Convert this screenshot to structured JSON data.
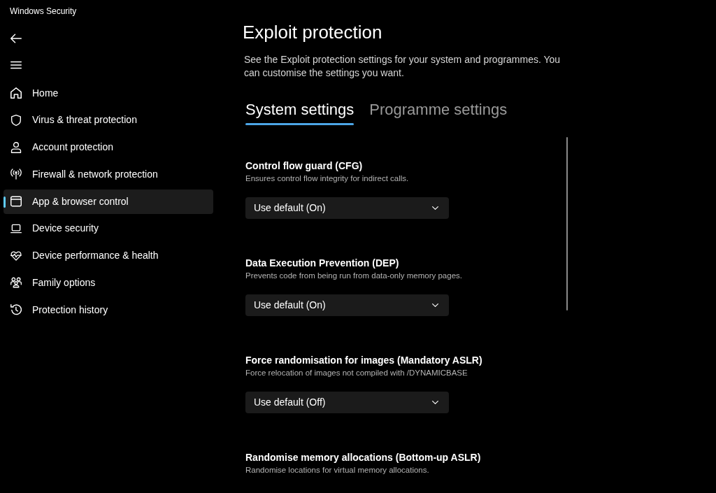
{
  "window": {
    "title": "Windows Security"
  },
  "sidebar": {
    "items": [
      {
        "label": "Home",
        "selected": false
      },
      {
        "label": "Virus & threat protection",
        "selected": false
      },
      {
        "label": "Account protection",
        "selected": false
      },
      {
        "label": "Firewall & network protection",
        "selected": false
      },
      {
        "label": "App & browser control",
        "selected": true
      },
      {
        "label": "Device security",
        "selected": false
      },
      {
        "label": "Device performance & health",
        "selected": false
      },
      {
        "label": "Family options",
        "selected": false
      },
      {
        "label": "Protection history",
        "selected": false
      }
    ]
  },
  "page": {
    "title": "Exploit protection",
    "description": "See the Exploit protection settings for your system and programmes. You can customise the settings you want.",
    "tabs": [
      {
        "label": "System settings",
        "selected": true
      },
      {
        "label": "Programme settings",
        "selected": false
      }
    ],
    "settings": [
      {
        "title": "Control flow guard (CFG)",
        "description": "Ensures control flow integrity for indirect calls.",
        "dropdown": {
          "value": "Use default (On)"
        }
      },
      {
        "title": "Data Execution Prevention (DEP)",
        "description": "Prevents code from being run from data-only memory pages.",
        "dropdown": {
          "value": "Use default (On)"
        }
      },
      {
        "title": "Force randomisation for images (Mandatory ASLR)",
        "description": "Force relocation of images not compiled with /DYNAMICBASE",
        "dropdown": {
          "value": "Use default (Off)"
        }
      },
      {
        "title": "Randomise memory allocations (Bottom-up ASLR)",
        "description": "Randomise locations for virtual memory allocations."
      }
    ]
  }
}
